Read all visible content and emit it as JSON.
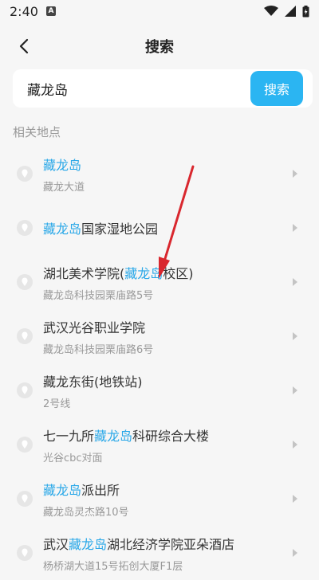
{
  "status_bar": {
    "time": "2:40",
    "notif": "A"
  },
  "header": {
    "title": "搜索"
  },
  "search": {
    "value": "藏龙岛",
    "button_label": "搜索"
  },
  "section_label": "相关地点",
  "results": [
    {
      "pre": "",
      "hl": "藏龙岛",
      "post": "",
      "sub": "藏龙大道"
    },
    {
      "pre": "",
      "hl": "藏龙岛",
      "post": "国家湿地公园",
      "sub": ""
    },
    {
      "pre": "湖北美术学院(",
      "hl": "藏龙岛",
      "post": "校区)",
      "sub": "藏龙岛科技园栗庙路5号"
    },
    {
      "pre": "武汉光谷职业学院",
      "hl": "",
      "post": "",
      "sub": "藏龙岛科技园栗庙路6号"
    },
    {
      "pre": "藏龙东街(地铁站)",
      "hl": "",
      "post": "",
      "sub": "2号线"
    },
    {
      "pre": "七一九所",
      "hl": "藏龙岛",
      "post": "科研综合大楼",
      "sub": "光谷cbc对面"
    },
    {
      "pre": "",
      "hl": "藏龙岛",
      "post": "派出所",
      "sub": "藏龙岛灵杰路10号"
    },
    {
      "pre": "武汉",
      "hl": "藏龙岛",
      "post": "湖北经济学院亚朵酒店",
      "sub": "杨桥湖大道15号拓创大厦F1层"
    }
  ],
  "colors": {
    "accent": "#2bb5f2",
    "highlight": "#2aa8e8",
    "annotation_arrow": "#d9272e"
  },
  "icons": {
    "back": "chevron-left-icon",
    "pin": "location-pin-icon",
    "row_arrow": "chevron-right-icon"
  }
}
